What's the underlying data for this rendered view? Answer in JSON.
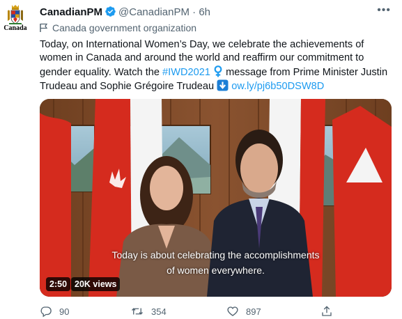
{
  "account": {
    "name": "CanadianPM",
    "handle": "@CanadianPM",
    "separator": "·",
    "time": "6h",
    "avatar_wordmark": "Canada",
    "label": "Canada government organization"
  },
  "tweet": {
    "text_1": "Today, on International Women’s Day, we celebrate the achievements of women in Canada and around the world and reaffirm our commitment to gender equality. Watch the ",
    "hashtag": "#IWD2021",
    "text_2": " message from Prime Minister Justin Trudeau and Sophie Grégoire Trudeau ",
    "link": "ow.ly/pj6b50DSW8D"
  },
  "media": {
    "caption_line_1": "Today is about celebrating the accomplishments",
    "caption_line_2": "of women everywhere.",
    "duration": "2:50",
    "views": "20K views"
  },
  "actions": {
    "replies": "90",
    "retweets": "354",
    "likes": "897"
  },
  "colors": {
    "link": "#1d9bf0",
    "verified": "#1d9bf0",
    "secondary_text": "#536471",
    "flag_red": "#d52b1e",
    "venus_symbol": "#1d9bf0"
  },
  "icons": [
    "canada-coat-of-arms-icon",
    "verified-badge-icon",
    "more-icon",
    "government-flag-icon",
    "venus-symbol-icon",
    "down-arrow-icon",
    "reply-icon",
    "retweet-icon",
    "like-icon",
    "share-icon"
  ]
}
